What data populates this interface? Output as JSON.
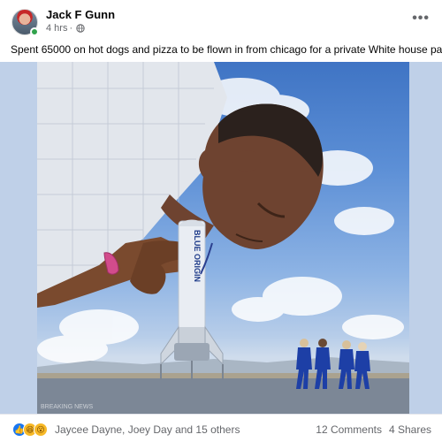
{
  "post": {
    "author": "Jack F Gunn",
    "time": "4 hrs",
    "time_separator": "·",
    "privacy_icon": "globe-icon",
    "more_options": "•••",
    "caption": "Spent 65000 on hot dogs and pizza to be flown in from chicago for a private White house party.",
    "image": {
      "rocket_text": "BLUE ORIGIN",
      "watermark": "BREAKING NEWS"
    }
  },
  "footer": {
    "reaction_icons": [
      "like-icon",
      "haha-icon",
      "wow-icon"
    ],
    "reaction_names": "Jaycee Dayne, Joey Day and 15 others",
    "comments": "12 Comments",
    "shares": "4 Shares"
  },
  "colors": {
    "like": "#1877f2",
    "online": "#31a24c",
    "secondary_text": "#65676b"
  }
}
